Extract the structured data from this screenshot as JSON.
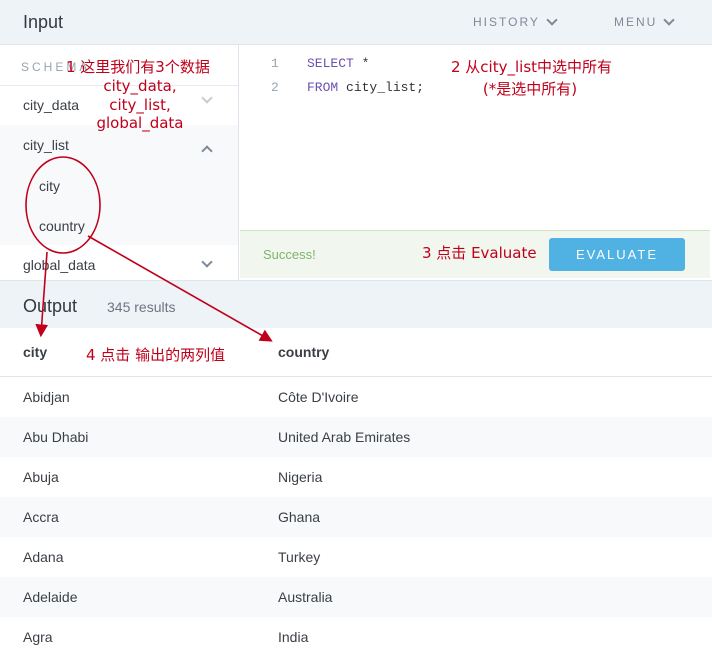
{
  "input": {
    "title": "Input",
    "history_label": "HISTORY",
    "menu_label": "MENU"
  },
  "schema": {
    "label": "SCHEMA",
    "tables": [
      {
        "name": "city_data",
        "expanded": false
      },
      {
        "name": "city_list",
        "expanded": true,
        "columns": [
          "city",
          "country"
        ]
      },
      {
        "name": "global_data",
        "expanded": false
      }
    ]
  },
  "editor": {
    "lines": [
      {
        "number": "1",
        "keyword": "SELECT",
        "rest": " *"
      },
      {
        "number": "2",
        "keyword": "FROM",
        "rest": " city_list;"
      }
    ]
  },
  "status": {
    "message": "Success!",
    "evaluate_label": "EVALUATE"
  },
  "output": {
    "title": "Output",
    "results_count": "345 results",
    "columns": [
      "city",
      "country"
    ],
    "rows": [
      [
        "Abidjan",
        "Côte D'Ivoire"
      ],
      [
        "Abu Dhabi",
        "United Arab Emirates"
      ],
      [
        "Abuja",
        "Nigeria"
      ],
      [
        "Accra",
        "Ghana"
      ],
      [
        "Adana",
        "Turkey"
      ],
      [
        "Adelaide",
        "Australia"
      ],
      [
        "Agra",
        "India"
      ]
    ]
  },
  "annotations": {
    "note1_line1": "1 这里我们有3个数据",
    "note1_line2": "city_data,",
    "note1_line3": "city_list,",
    "note1_line4": "global_data",
    "note2_line1": "2 从city_list中选中所有",
    "note2_line2": "(*是选中所有)",
    "note3": "3 点击 Evaluate",
    "note4": "4 点击 输出的两列值",
    "color": "#c0001a"
  }
}
